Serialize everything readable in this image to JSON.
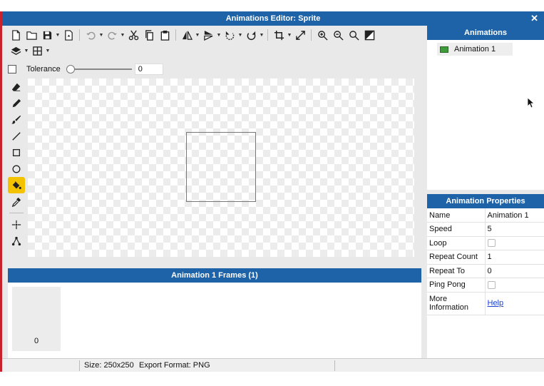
{
  "window": {
    "title": "Animations Editor: Sprite",
    "close_glyph": "✕"
  },
  "toolbar": {
    "row1": [
      "new-file-icon",
      "open-folder-icon",
      "save-icon",
      "export-icon",
      "undo-icon",
      "redo-icon",
      "cut-icon",
      "copy-icon",
      "paste-icon",
      "flip-horizontal-icon",
      "flip-vertical-icon",
      "rotate-ccw-icon",
      "rotate-cw-icon",
      "crop-icon",
      "resize-icon",
      "zoom-in-icon",
      "zoom-out-icon",
      "zoom-reset-icon",
      "fit-icon"
    ],
    "row2": [
      "layers-icon",
      "grid-icon"
    ]
  },
  "tolerance": {
    "label": "Tolerance",
    "value": "0",
    "level": 0
  },
  "tools": [
    "eraser-icon",
    "pencil-icon",
    "brush-icon",
    "line-icon",
    "rectangle-icon",
    "ellipse-icon",
    "fill-bucket-icon",
    "eyedropper-icon",
    "point-icon",
    "node-icon"
  ],
  "frames": {
    "title": "Animation 1 Frames (1)",
    "items": [
      {
        "index": "0"
      }
    ]
  },
  "animations": {
    "title": "Animations",
    "items": [
      {
        "label": "Animation 1",
        "color": "#3e9a3a"
      }
    ]
  },
  "properties": {
    "title": "Animation Properties",
    "rows": [
      {
        "key": "Name",
        "value": "Animation 1"
      },
      {
        "key": "Speed",
        "value": "5"
      },
      {
        "key": "Loop",
        "value": ""
      },
      {
        "key": "Repeat Count",
        "value": "1"
      },
      {
        "key": "Repeat To",
        "value": "0"
      },
      {
        "key": "Ping Pong",
        "value": ""
      },
      {
        "key": "More Information",
        "value": "Help"
      }
    ]
  },
  "status": {
    "size": "Size: 250x250",
    "export_format": "Export Format: PNG"
  },
  "colors": {
    "header": "#1e63a8",
    "active_tool": "#f3c200",
    "accent_edge": "#c8232c"
  }
}
